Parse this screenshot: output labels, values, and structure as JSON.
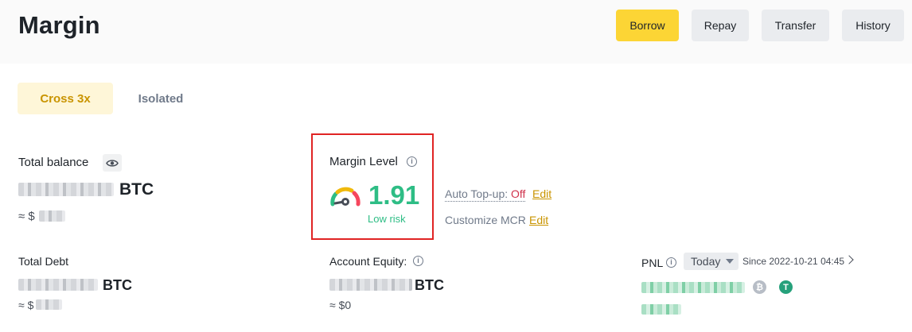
{
  "header": {
    "title": "Margin",
    "buttons": {
      "borrow": "Borrow",
      "repay": "Repay",
      "transfer": "Transfer",
      "history": "History"
    }
  },
  "tabs": {
    "cross": "Cross 3x",
    "isolated": "Isolated"
  },
  "balance": {
    "label": "Total balance",
    "unit": "BTC",
    "approx": "≈ $"
  },
  "margin_level": {
    "label": "Margin Level",
    "value": "1.91",
    "risk": "Low risk",
    "auto_topup_label": "Auto Top-up:",
    "auto_topup_state": "Off",
    "edit_label": "Edit",
    "customize_label": "Customize MCR",
    "gauge_colors": [
      "#2ebd85",
      "#f0b90b",
      "#f6465d"
    ]
  },
  "debt": {
    "label": "Total Debt",
    "unit": "BTC",
    "approx": "≈ $"
  },
  "equity": {
    "label": "Account Equity:",
    "unit": "BTC",
    "approx": "≈ $0"
  },
  "pnl": {
    "label": "PNL",
    "period": "Today",
    "since": "Since 2022-10-21 04:45",
    "coins": {
      "btc": "₿",
      "usdt": "T"
    }
  },
  "icons": {
    "info": "i"
  }
}
